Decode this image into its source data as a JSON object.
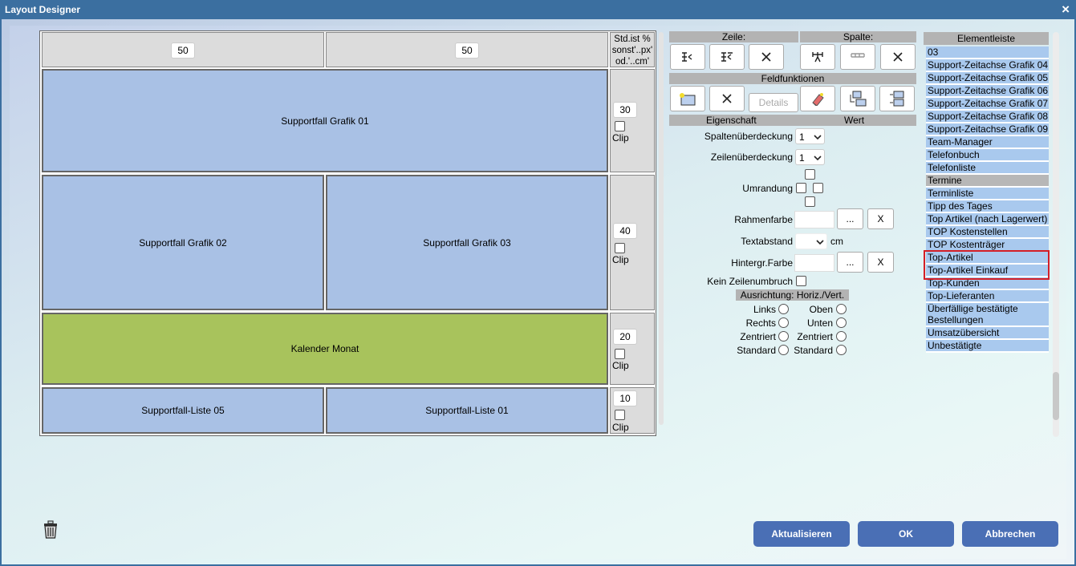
{
  "window": {
    "title": "Layout Designer",
    "close": "×"
  },
  "grid": {
    "widths": [
      "50",
      "50"
    ],
    "unit_header": "Std.ist % sonst'..px' od.'..cm'",
    "rows": [
      {
        "height": "30",
        "clip": "Clip",
        "cells": [
          "Supportfall Grafik 01"
        ]
      },
      {
        "height": "40",
        "clip": "Clip",
        "cells": [
          "Supportfall Grafik 02",
          "Supportfall Grafik 03"
        ]
      },
      {
        "height": "20",
        "clip": "Clip",
        "cells": [
          "Kalender Monat"
        ]
      },
      {
        "height": "10",
        "clip": "Clip",
        "cells": [
          "Supportfall-Liste 05",
          "Supportfall-Liste 01"
        ]
      }
    ]
  },
  "panel": {
    "zeile": "Zeile:",
    "spalte": "Spalte:",
    "feldfunktionen": "Feldfunktionen",
    "details": "Details",
    "eigenschaft": "Eigenschaft",
    "wert": "Wert",
    "spaltenueberdeckung": "Spaltenüberdeckung",
    "spaltenueberdeckung_value": "1",
    "zeilenueberdeckung": "Zeilenüberdeckung",
    "zeilenueberdeckung_value": "1",
    "umrandung": "Umrandung",
    "rahmenfarbe": "Rahmenfarbe",
    "textabstand": "Textabstand",
    "cm": "cm",
    "hintergrund": "Hintergr.Farbe",
    "dots": "...",
    "x": "X",
    "kein_zeilenumbruch": "Kein Zeilenumbruch",
    "ausrichtung": "Ausrichtung: Horiz./Vert.",
    "horiz": [
      "Links",
      "Rechts",
      "Zentriert",
      "Standard"
    ],
    "vert": [
      "Oben",
      "Unten",
      "Zentriert",
      "Standard"
    ]
  },
  "elementleiste": {
    "title": "Elementleiste",
    "items": [
      "03",
      "Support-Zeitachse Grafik 04",
      "Support-Zeitachse Grafik 05",
      "Support-Zeitachse Grafik 06",
      "Support-Zeitachse Grafik 07",
      "Support-Zeitachse Grafik 08",
      "Support-Zeitachse Grafik 09",
      "Team-Manager",
      "Telefonbuch",
      "Telefonliste",
      "Termine",
      "Terminliste",
      "Tipp des Tages",
      "Top Artikel (nach Lagerwert)",
      "TOP Kostenstellen",
      "TOP Kostenträger",
      "Top-Artikel",
      "Top-Artikel Einkauf",
      "Top-Kunden",
      "Top-Lieferanten",
      "Überfällige bestätigte Bestellungen",
      "Umsatzübersicht",
      "Unbestätigte"
    ]
  },
  "buttons": {
    "refresh": "Aktualisieren",
    "ok": "OK",
    "cancel": "Abbrechen"
  },
  "colors": {
    "titlebar": "#3b6fa0",
    "cell_blue": "#a9c1e5",
    "cell_green": "#a8c35c",
    "button": "#4a6fb5",
    "highlight": "#d41f27"
  }
}
